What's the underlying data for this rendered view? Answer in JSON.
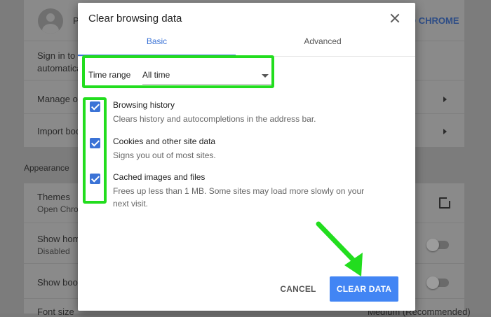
{
  "background": {
    "profile_initial": "P",
    "sign_in_text": "Sign in to g",
    "sign_in_sub": "automatica",
    "sign_in_link": "O CHROME",
    "manage_text": "Manage oth",
    "import_text": "Import boo",
    "appearance_heading": "Appearance",
    "themes_title": "Themes",
    "themes_sub": "Open Chro",
    "home_title": "Show home",
    "home_sub": "Disabled",
    "bookmarks_title": "Show book",
    "font_title": "Font size",
    "font_value": "Medium (Recommended)"
  },
  "dialog": {
    "title": "Clear browsing data",
    "tabs": [
      {
        "label": "Basic",
        "active": true
      },
      {
        "label": "Advanced",
        "active": false
      }
    ],
    "time_range": {
      "label": "Time range",
      "value": "All time"
    },
    "items": [
      {
        "title": "Browsing history",
        "desc": "Clears history and autocompletions in the address bar.",
        "checked": true
      },
      {
        "title": "Cookies and other site data",
        "desc": "Signs you out of most sites.",
        "checked": true
      },
      {
        "title": "Cached images and files",
        "desc": "Frees up less than 1 MB. Some sites may load more slowly on your next visit.",
        "checked": true
      }
    ],
    "buttons": {
      "cancel": "CANCEL",
      "clear": "CLEAR DATA"
    }
  },
  "colors": {
    "accent": "#4285f4",
    "highlight": "#22dd1e",
    "overlay": "#7c7c7c"
  },
  "icons": [
    "avatar-icon",
    "chevron-right-icon",
    "external-link-icon",
    "close-icon",
    "dropdown-arrow-icon",
    "checkmark-icon",
    "green-arrow-icon"
  ]
}
